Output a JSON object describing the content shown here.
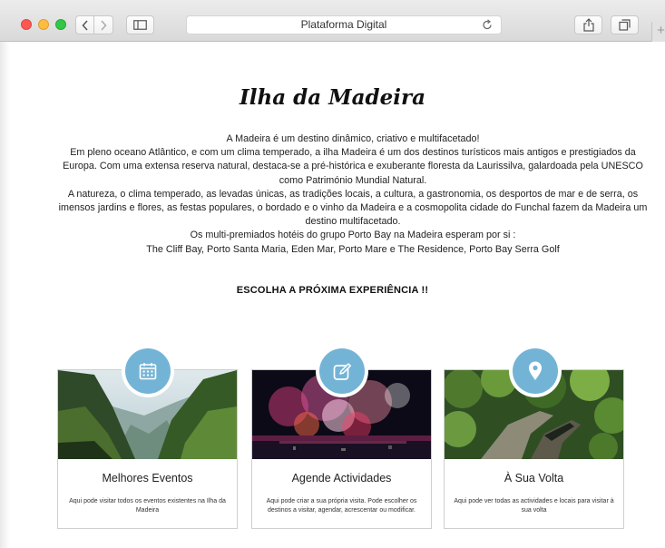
{
  "browser": {
    "url_title": "Plataforma Digital",
    "new_tab_symbol": "+"
  },
  "page": {
    "title": "Ilha da Madeira",
    "intro": [
      "A Madeira é um destino dinâmico, criativo e multifacetado!",
      "Em pleno oceano Atlântico, e com um clima temperado, a ilha Madeira é um dos destinos turísticos mais antigos e prestigiados da Europa. Com uma extensa reserva natural, destaca-se a pré-histórica e exuberante floresta da Laurissilva, galardoada pela UNESCO como Património Mundial Natural.",
      "A natureza, o clima temperado, as levadas únicas, as tradições locais, a cultura, a gastronomia, os desportos de mar e de serra, os imensos jardins e flores, as festas populares, o bordado e o vinho da Madeira e a cosmopolita cidade do Funchal fazem da Madeira um destino multifacetado.",
      "Os multi-premiados hotéis do grupo Porto Bay na Madeira esperam por si :",
      "The Cliff Bay, Porto Santa Maria, Eden Mar, Porto Mare e The Residence, Porto Bay Serra Golf"
    ],
    "choose_heading": "ESCOLHA A PRÓXIMA EXPERIÊNCIA !!"
  },
  "cards": [
    {
      "title": "Melhores Eventos",
      "description": "Aqui pode visitar todos os eventos existentes na Ilha da Madeira",
      "icon": "calendar-icon"
    },
    {
      "title": "Agende Actividades",
      "description": "Aqui pode criar a sua própria visita. Pode escolher os destinos a visitar, agendar, acrescentar ou modificar.",
      "icon": "edit-icon"
    },
    {
      "title": "À Sua Volta",
      "description": "Aqui pode ver todas as actividades e locais para visitar à sua volta",
      "icon": "location-pin-icon"
    }
  ],
  "colors": {
    "accent": "#73b4d6",
    "traffic_red": "#fc5753",
    "traffic_yellow": "#fdbc40",
    "traffic_green": "#33c748"
  }
}
